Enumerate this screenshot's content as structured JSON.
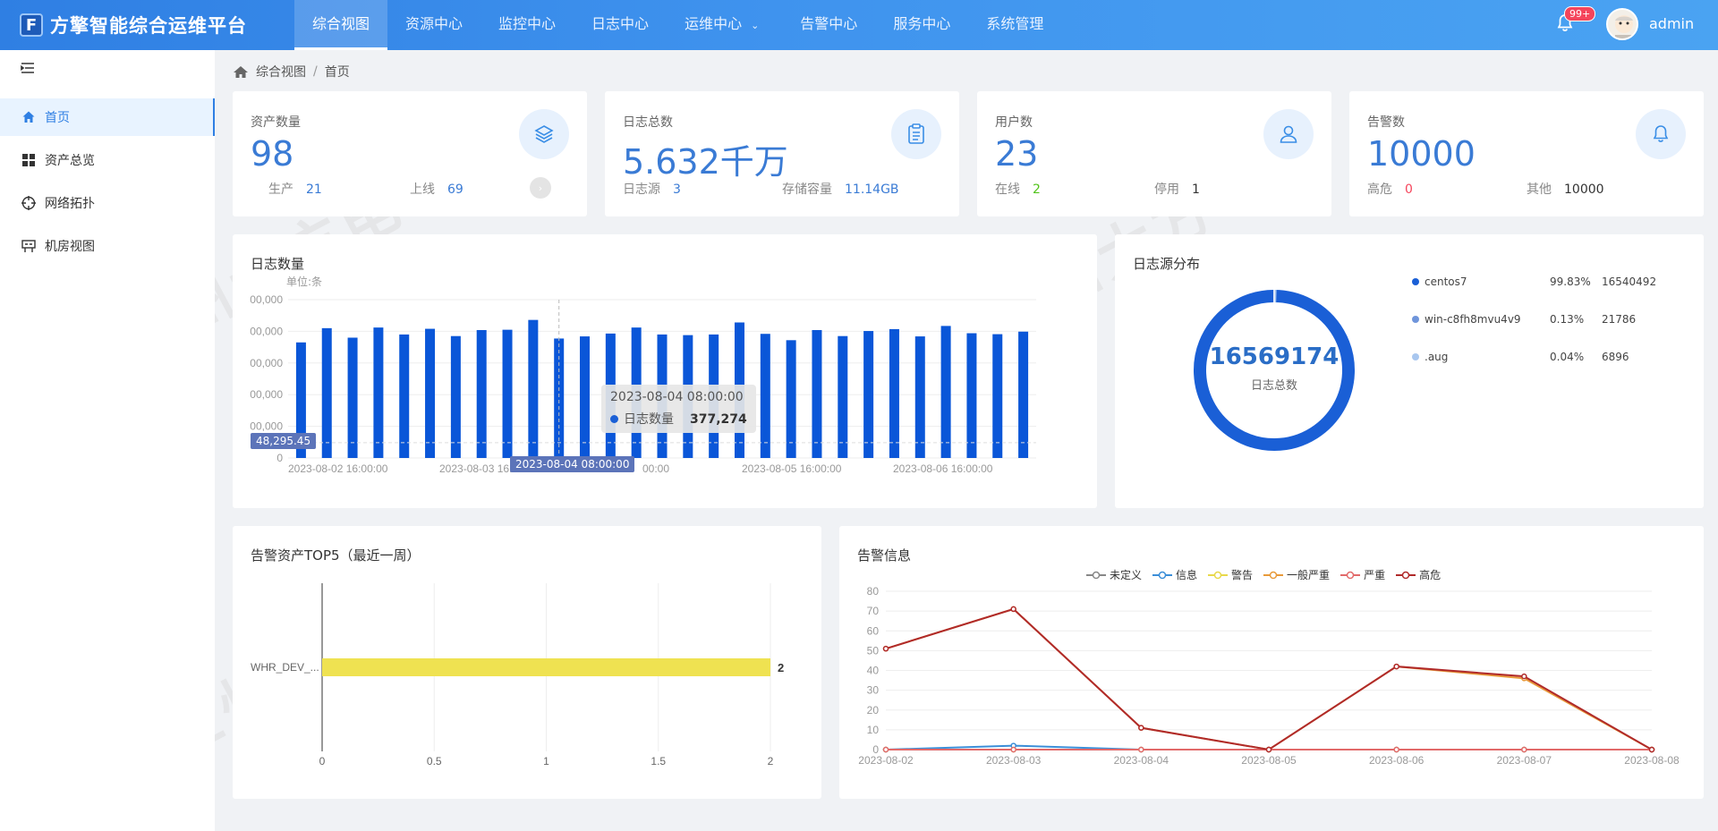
{
  "header": {
    "brand_logo_letter": "F",
    "title": "方擎智能综合运维平台",
    "nav": [
      {
        "label": "综合视图",
        "active": true
      },
      {
        "label": "资源中心"
      },
      {
        "label": "监控中心"
      },
      {
        "label": "日志中心"
      },
      {
        "label": "运维中心",
        "has_caret": true
      },
      {
        "label": "告警中心"
      },
      {
        "label": "服务中心"
      },
      {
        "label": "系统管理"
      }
    ],
    "notification_badge": "99+",
    "username": "admin"
  },
  "sidebar": {
    "items": [
      {
        "label": "首页",
        "icon": "home-icon",
        "active": true
      },
      {
        "label": "资产总览",
        "icon": "grid-icon"
      },
      {
        "label": "网络拓扑",
        "icon": "target-icon"
      },
      {
        "label": "机房视图",
        "icon": "rack-icon"
      }
    ]
  },
  "breadcrumb": {
    "parent": "综合视图",
    "separator": "/",
    "current": "首页"
  },
  "stats": {
    "assets": {
      "label": "资产数量",
      "value": "98",
      "sub1_label": "生产",
      "sub1_value": "21",
      "sub2_label": "上线",
      "sub2_value": "69"
    },
    "logs": {
      "label": "日志总数",
      "value": "5.632千万",
      "sub1_label": "日志源",
      "sub1_value": "3",
      "sub2_label": "存储容量",
      "sub2_value": "11.14GB"
    },
    "users": {
      "label": "用户数",
      "value": "23",
      "sub1_label": "在线",
      "sub1_value": "2",
      "sub2_label": "停用",
      "sub2_value": "1"
    },
    "alerts": {
      "label": "告警数",
      "value": "10000",
      "sub1_label": "高危",
      "sub1_value": "0",
      "sub2_label": "其他",
      "sub2_value": "10000"
    }
  },
  "log_count_panel": {
    "title": "日志数量",
    "unit": "单位:条",
    "y_tick_labels": [
      "00,000",
      "00,000",
      "00,000",
      "00,000",
      "00,000",
      "0"
    ],
    "x_tick_labels": [
      "2023-08-02 16:00:00",
      "2023-08-03 16:00:00",
      "00:00",
      "2023-08-05 16:00:00",
      "2023-08-06 16:00:00"
    ],
    "tooltip": {
      "time": "2023-08-04 08:00:00",
      "series": "日志数量",
      "value": "377,274"
    },
    "axis_pointer_label": "2023-08-04 08:00:00",
    "y_pointer_label": "48,295.45"
  },
  "log_source_panel": {
    "title": "日志源分布",
    "total": "16569174",
    "total_label": "日志总数",
    "legend": [
      {
        "name": "centos7",
        "percent": "99.83%",
        "count": "16540492",
        "color": "#1a5fd6"
      },
      {
        "name": "win-c8fh8mvu4v9",
        "percent": "0.13%",
        "count": "21786",
        "color": "#6f95db"
      },
      {
        "name": ".aug",
        "percent": "0.04%",
        "count": "6896",
        "color": "#a9c7ef"
      }
    ]
  },
  "alert_top5_panel": {
    "title": "告警资产TOP5（最近一周）",
    "category_label": "WHR_DEV_...",
    "value_label": "2",
    "x_tick_labels": [
      "0",
      "0.5",
      "1",
      "1.5",
      "2"
    ]
  },
  "alert_info_panel": {
    "title": "告警信息",
    "legend": [
      {
        "name": "未定义",
        "color": "#888888"
      },
      {
        "name": "信息",
        "color": "#3b8ed8"
      },
      {
        "name": "警告",
        "color": "#e8d84a"
      },
      {
        "name": "一般严重",
        "color": "#e89a3a"
      },
      {
        "name": "严重",
        "color": "#e26a6a"
      },
      {
        "name": "高危",
        "color": "#b02a2a"
      }
    ],
    "y_tick_labels": [
      "80",
      "70",
      "60",
      "50",
      "40",
      "30",
      "20",
      "10",
      "0"
    ],
    "x_tick_labels": [
      "2023-08-02",
      "2023-08-03",
      "2023-08-04",
      "2023-08-05",
      "2023-08-06",
      "2023-08-07",
      "2023-08-08"
    ]
  },
  "watermark_text": "兰州大方电子",
  "chart_data": [
    {
      "type": "bar",
      "title": "日志数量",
      "ylabel": "单位:条",
      "x_start": "2023-08-02 16:00:00",
      "x_end": "2023-08-06 16:00:00",
      "series": [
        {
          "name": "日志数量",
          "values": [
            365000,
            410000,
            380000,
            412000,
            390000,
            408000,
            385000,
            404000,
            405000,
            436000,
            377274,
            384000,
            393000,
            412000,
            390000,
            388000,
            390000,
            428000,
            392000,
            372000,
            404000,
            385000,
            401000,
            407000,
            384000,
            417000,
            394000,
            391000,
            399000
          ]
        }
      ],
      "ylim": [
        0,
        500000
      ],
      "highlight": {
        "time": "2023-08-04 08:00:00",
        "value": 377274
      },
      "reference_line": 48295.45
    },
    {
      "type": "pie",
      "title": "日志源分布",
      "categories": [
        "centos7",
        "win-c8fh8mvu4v9",
        ".aug"
      ],
      "values": [
        16540492,
        21786,
        6896
      ]
    },
    {
      "type": "bar",
      "title": "告警资产TOP5（最近一周）",
      "orientation": "horizontal",
      "categories": [
        "WHR_DEV_..."
      ],
      "values": [
        2
      ],
      "xlim": [
        0,
        2
      ]
    },
    {
      "type": "line",
      "title": "告警信息",
      "categories": [
        "2023-08-02",
        "2023-08-03",
        "2023-08-04",
        "2023-08-05",
        "2023-08-06",
        "2023-08-07",
        "2023-08-08"
      ],
      "series": [
        {
          "name": "未定义",
          "values": [
            0,
            0,
            0,
            0,
            0,
            0,
            0
          ]
        },
        {
          "name": "信息",
          "values": [
            0,
            2,
            0,
            0,
            0,
            0,
            0
          ]
        },
        {
          "name": "警告",
          "values": [
            0,
            0,
            0,
            0,
            0,
            0,
            0
          ]
        },
        {
          "name": "一般严重",
          "values": [
            51,
            71,
            11,
            0,
            42,
            36,
            0
          ]
        },
        {
          "name": "严重",
          "values": [
            0,
            0,
            0,
            0,
            0,
            0,
            0
          ]
        },
        {
          "name": "高危",
          "values": [
            51,
            71,
            11,
            0,
            42,
            37,
            0
          ]
        }
      ],
      "ylim": [
        0,
        80
      ]
    }
  ]
}
